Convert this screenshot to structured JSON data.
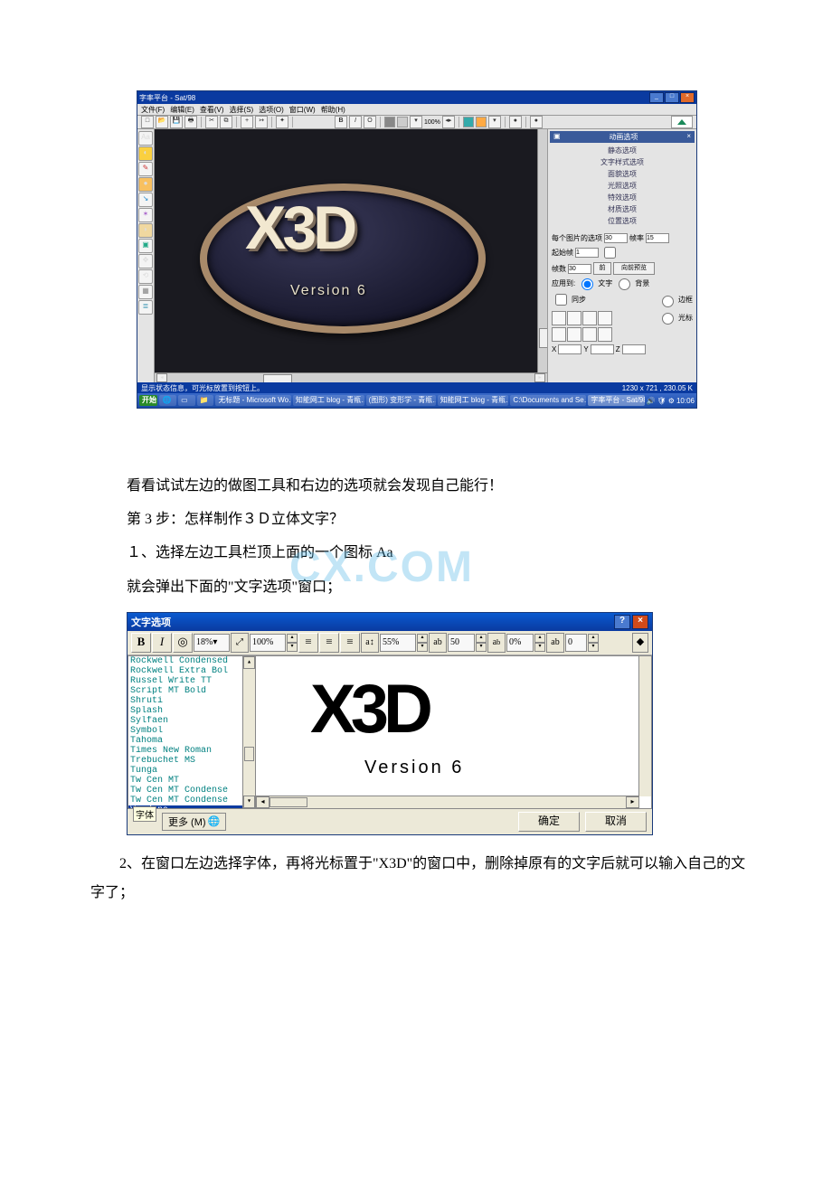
{
  "watermark": "CX.COM",
  "app": {
    "title": "字率平台 - Sat/98",
    "menu": [
      "文件(F)",
      "编辑(E)",
      "查看(V)",
      "选择(S)",
      "选项(O)",
      "窗口(W)",
      "帮助(H)"
    ],
    "canvas": {
      "logo_text": "X3D",
      "version": "Version 6"
    },
    "panel": {
      "header": "动画选项",
      "items": [
        "静态选项",
        "文字样式选项",
        "面貌选项",
        "光照选项",
        "特效选项",
        "材质选项",
        "位置选项"
      ],
      "row1_label": "每个图片的选项",
      "row1_val": "30",
      "row1_right_label": "帧率",
      "row1_right_val": "15",
      "row2_label": "起始帧",
      "row2_val": "1",
      "row3_label": "帧数",
      "row3_val": "30",
      "btn1": "前",
      "btn2": "向前预览",
      "radio1_label": "文字",
      "radio2_label": "背景",
      "grid_labels": [
        "边框",
        "光标"
      ],
      "coord_labels": [
        "X",
        "Y",
        "Z"
      ]
    },
    "status_left": "显示状态信息，可光标放置到按钮上。",
    "status_right": "1230 x 721 , 230.05 K",
    "taskbar": {
      "start": "开始",
      "items": [
        "无标题 - Microsoft Wo…",
        "知能网工 blog - 青瓶…",
        "(图形) 变形学 - 青瓶…",
        "知能网工 blog - 青瓶…",
        "C:\\Documents and Se…",
        "字率平台 - Sat/98"
      ],
      "time": "10:06"
    }
  },
  "text": {
    "p1": "看看试试左边的做图工具和右边的选项就会发现自己能行！",
    "p2": "第 3 步：怎样制作３Ｄ立体文字？",
    "p3": "１、选择左边工具栏顶上面的一个图标 Aa",
    "p4": "就会弹出下面的\"文字选项\"窗口；",
    "p5": "2、在窗口左边选择字体，再将光标置于\"X3D\"的窗口中，删除掉原有的文字后就可以输入自己的文字了；"
  },
  "dlg": {
    "title": "文字选项",
    "toolbar": {
      "size_pct": "18%",
      "scale_pct": "100%",
      "kern_label": "ab",
      "kern_pct": "55%",
      "track_label": "ab",
      "track_val": "50",
      "sub_label": "ab",
      "sub_val": "0%",
      "lead_label": "ab",
      "lead_val": "0"
    },
    "fonts": [
      "Rockwell Condensed",
      "Rockwell Extra Bol",
      "Russel Write TT",
      "Script MT Bold",
      "Shruti",
      "Splash",
      "Sylfaen",
      "Symbol",
      "Tahoma",
      "Times New Roman",
      "Trebuchet MS",
      "Tunga",
      "Tw Cen MT",
      "Tw Cen MT Condense",
      "Tw Cen MT Condense",
      "Verdana"
    ],
    "selected_font_index": 15,
    "preview_main": "X3D",
    "preview_sub": "Version 6",
    "font_tooltip": "字体",
    "more_btn": "更多 (M)",
    "ok": "确定",
    "cancel": "取消"
  }
}
